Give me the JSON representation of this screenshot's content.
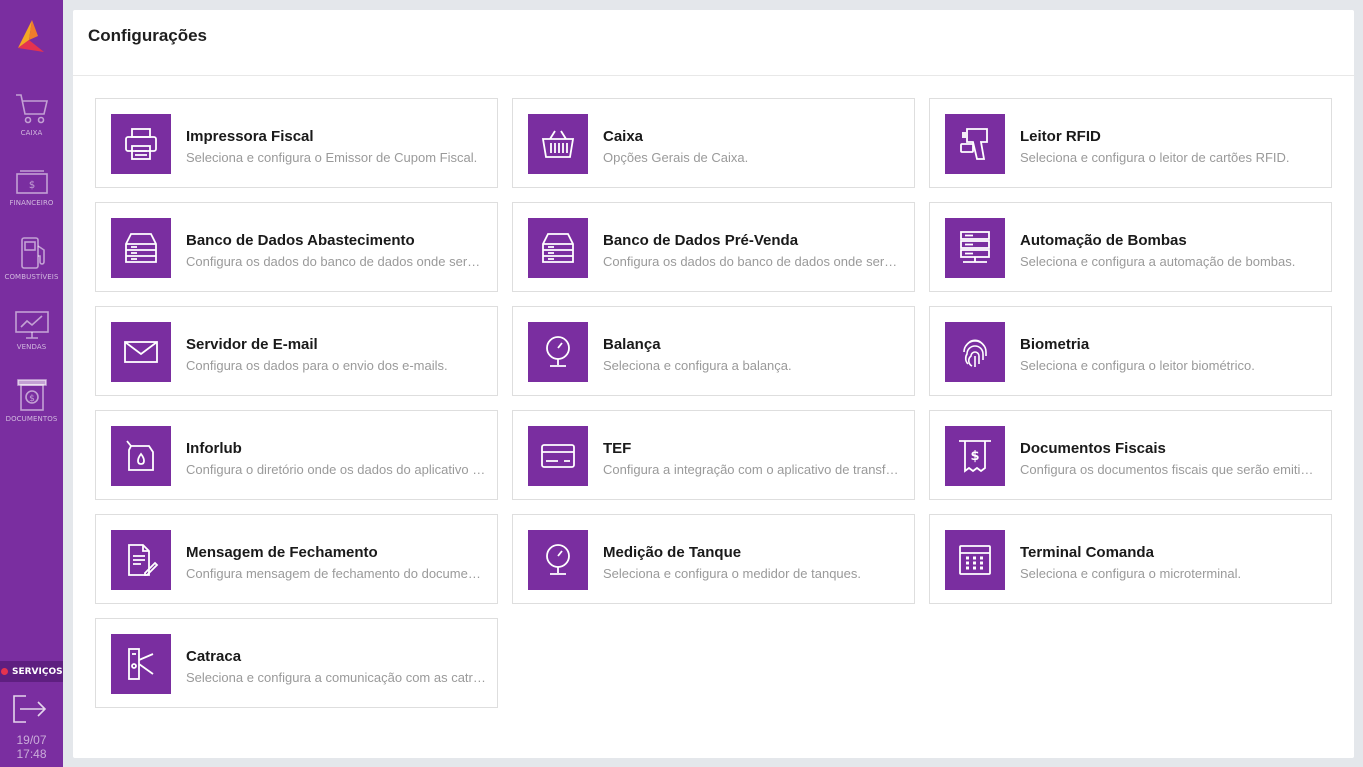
{
  "sidebar": {
    "items": [
      {
        "label": "CAIXA"
      },
      {
        "label": "FINANCEIRO"
      },
      {
        "label": "COMBUSTÍVEIS"
      },
      {
        "label": "VENDAS"
      },
      {
        "label": "DOCUMENTOS"
      }
    ],
    "services_label": "SERVIÇOS",
    "date": "19/07",
    "time": "17:48"
  },
  "page": {
    "title": "Configurações"
  },
  "cards": [
    {
      "title": "Impressora Fiscal",
      "desc": "Seleciona e configura o Emissor de Cupom Fiscal.",
      "icon": "printer-icon"
    },
    {
      "title": "Caixa",
      "desc": "Opções Gerais de Caixa.",
      "icon": "basket-icon"
    },
    {
      "title": "Leitor RFID",
      "desc": "Seleciona e configura o leitor de cartões RFID.",
      "icon": "rfid-reader-icon"
    },
    {
      "title": "Banco de Dados Abastecimento",
      "desc": "Configura os dados do banco de dados onde serão gravados os abastecimentos.",
      "icon": "database-icon"
    },
    {
      "title": "Banco de Dados Pré-Venda",
      "desc": "Configura os dados do banco de dados onde serão gravadas as pré-vendas.",
      "icon": "database-icon"
    },
    {
      "title": "Automação de Bombas",
      "desc": "Seleciona e configura a automação de bombas.",
      "icon": "server-icon"
    },
    {
      "title": "Servidor de E-mail",
      "desc": "Configura os dados para o envio dos e-mails.",
      "icon": "envelope-icon"
    },
    {
      "title": "Balança",
      "desc": "Seleciona e configura a balança.",
      "icon": "scale-icon"
    },
    {
      "title": "Biometria",
      "desc": "Seleciona e configura o leitor biométrico.",
      "icon": "fingerprint-icon"
    },
    {
      "title": "Inforlub",
      "desc": "Configura o diretório onde os dados do aplicativo Inforlub serão gravados.",
      "icon": "oil-can-icon"
    },
    {
      "title": "TEF",
      "desc": "Configura a integração com o aplicativo de transferência eletrônica de fundos.",
      "icon": "card-icon"
    },
    {
      "title": "Documentos Fiscais",
      "desc": "Configura os documentos fiscais que serão emitidos.",
      "icon": "receipt-icon"
    },
    {
      "title": "Mensagem de Fechamento",
      "desc": "Configura mensagem de fechamento do documento fiscal.",
      "icon": "document-edit-icon"
    },
    {
      "title": "Medição de Tanque",
      "desc": "Seleciona e configura o medidor de tanques.",
      "icon": "gauge-icon"
    },
    {
      "title": "Terminal Comanda",
      "desc": "Seleciona e configura o microterminal.",
      "icon": "terminal-icon"
    },
    {
      "title": "Catraca",
      "desc": "Seleciona e configura a comunicação com as catracas.",
      "icon": "turnstile-icon"
    }
  ],
  "colors": {
    "accent": "#7a2ea0",
    "sidebar_dark": "#5e1f80",
    "status_dot": "#e5334f"
  }
}
